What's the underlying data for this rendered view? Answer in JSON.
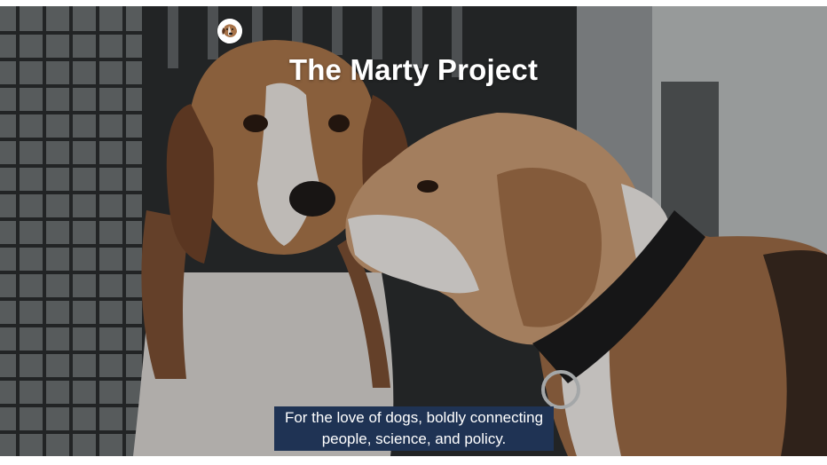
{
  "hero": {
    "title": "The Marty Project",
    "tagline_line1": "For the love of dogs, boldly connecting",
    "tagline_line2": "people, science, and policy.",
    "logo_icon": "beagle-logo-icon",
    "tagline_bg": "#1f3354",
    "title_color": "#ffffff"
  }
}
